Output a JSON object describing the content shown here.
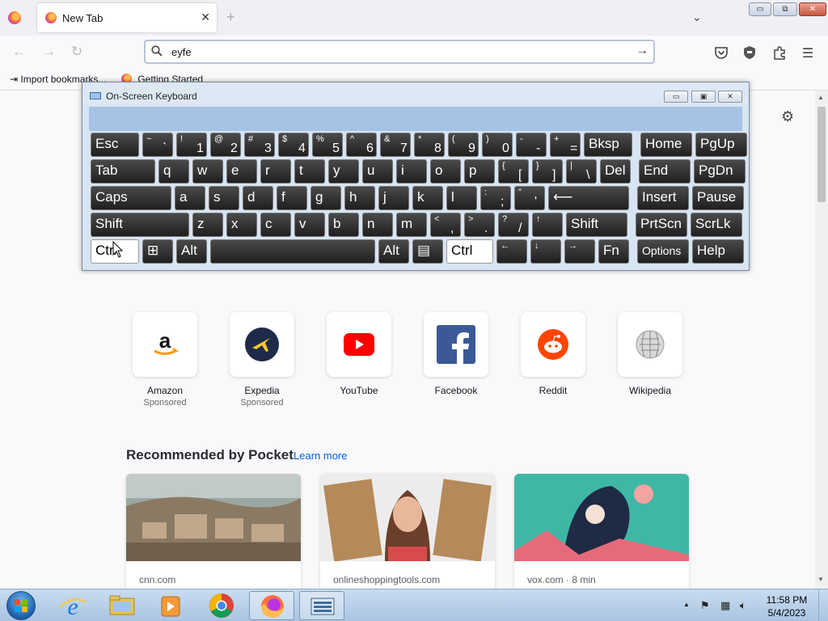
{
  "browser": {
    "tab_title": "New Tab",
    "tab_close": "✕",
    "new_tab": "+",
    "tab_list": "⌄",
    "url_value": "eyfe",
    "go_arrow": "→",
    "back": "←",
    "forward": "→",
    "reload": "↻",
    "window_controls": {
      "minimize": "▭",
      "maximize": "⧉",
      "close": "✕"
    },
    "menu": "☰"
  },
  "bookmarks": [
    {
      "label": "Import bookmarks..."
    },
    {
      "label": "Getting Started"
    }
  ],
  "settings_icon": "⚙",
  "shortcuts": [
    {
      "name": "Amazon",
      "sub": "Sponsored"
    },
    {
      "name": "Expedia",
      "sub": "Sponsored"
    },
    {
      "name": "YouTube",
      "sub": ""
    },
    {
      "name": "Facebook",
      "sub": ""
    },
    {
      "name": "Reddit",
      "sub": ""
    },
    {
      "name": "Wikipedia",
      "sub": ""
    }
  ],
  "pocket": {
    "heading": "Recommended by Pocket",
    "learn_more": "Learn more",
    "cards": [
      {
        "source": "cnn.com"
      },
      {
        "source": "onlineshoppingtools.com"
      },
      {
        "source": "vox.com · 8 min"
      }
    ]
  },
  "osk": {
    "title": "On-Screen Keyboard",
    "controls": {
      "minimize": "▭",
      "restore": "▣",
      "close": "✕"
    },
    "rows": [
      [
        {
          "m": "Esc"
        },
        {
          "u": "~",
          "l": "`"
        },
        {
          "u": "!",
          "l": "1"
        },
        {
          "u": "@",
          "l": "2"
        },
        {
          "u": "#",
          "l": "3"
        },
        {
          "u": "$",
          "l": "4"
        },
        {
          "u": "%",
          "l": "5"
        },
        {
          "u": "^",
          "l": "6"
        },
        {
          "u": "&",
          "l": "7"
        },
        {
          "u": "*",
          "l": "8"
        },
        {
          "u": "(",
          "l": "9"
        },
        {
          "u": ")",
          "l": "0"
        },
        {
          "u": "-",
          "l": "-"
        },
        {
          "u": "+",
          "l": "="
        },
        {
          "m": "Bksp"
        },
        {
          "m": "Home"
        },
        {
          "m": "PgUp"
        }
      ],
      [
        {
          "m": "Tab"
        },
        {
          "m": "q"
        },
        {
          "m": "w"
        },
        {
          "m": "e"
        },
        {
          "m": "r"
        },
        {
          "m": "t"
        },
        {
          "m": "y"
        },
        {
          "m": "u"
        },
        {
          "m": "i"
        },
        {
          "m": "o"
        },
        {
          "m": "p"
        },
        {
          "u": "{",
          "l": "["
        },
        {
          "u": "}",
          "l": "]"
        },
        {
          "u": "|",
          "l": "\\"
        },
        {
          "m": "Del"
        },
        {
          "m": "End"
        },
        {
          "m": "PgDn"
        }
      ],
      [
        {
          "m": "Caps"
        },
        {
          "m": "a"
        },
        {
          "m": "s"
        },
        {
          "m": "d"
        },
        {
          "m": "f"
        },
        {
          "m": "g"
        },
        {
          "m": "h"
        },
        {
          "m": "j"
        },
        {
          "m": "k"
        },
        {
          "m": "l"
        },
        {
          "u": ":",
          "l": ";"
        },
        {
          "u": "\"",
          "l": "'"
        },
        {
          "m": "⟵"
        },
        {
          "m": "Insert"
        },
        {
          "m": "Pause"
        }
      ],
      [
        {
          "m": "Shift"
        },
        {
          "m": "z"
        },
        {
          "m": "x"
        },
        {
          "m": "c"
        },
        {
          "m": "v"
        },
        {
          "m": "b"
        },
        {
          "m": "n"
        },
        {
          "m": "m"
        },
        {
          "u": "<",
          "l": ","
        },
        {
          "u": ">",
          "l": "."
        },
        {
          "u": "?",
          "l": "/"
        },
        {
          "u": "↑",
          "l": ""
        },
        {
          "m": "Shift"
        },
        {
          "m": "PrtScn"
        },
        {
          "m": "ScrLk"
        }
      ],
      [
        {
          "m": "Ctrl"
        },
        {
          "m": "⊞"
        },
        {
          "m": "Alt"
        },
        {
          "m": ""
        },
        {
          "m": "Alt"
        },
        {
          "m": "▤"
        },
        {
          "m": "Ctrl"
        },
        {
          "u": "←",
          "l": ""
        },
        {
          "u": "↓",
          "l": ""
        },
        {
          "u": "→",
          "l": ""
        },
        {
          "m": "Fn"
        },
        {
          "m": "Options"
        },
        {
          "m": "Help"
        }
      ]
    ]
  },
  "taskbar": {
    "tray_arrow": "▲",
    "time": "11:58 PM",
    "date": "5/4/2023"
  }
}
